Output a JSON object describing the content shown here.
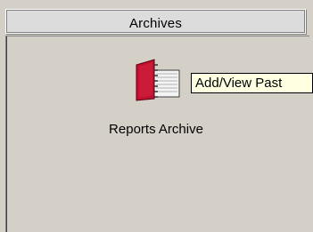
{
  "header": {
    "title": "Archives"
  },
  "item": {
    "label": "Reports Archive",
    "icon": "red-book-icon"
  },
  "tooltip": {
    "text": "Add/View Past"
  },
  "colors": {
    "panel_bg": "#d4d0c8",
    "tooltip_bg": "#ffffe1",
    "book_red": "#c01030"
  }
}
